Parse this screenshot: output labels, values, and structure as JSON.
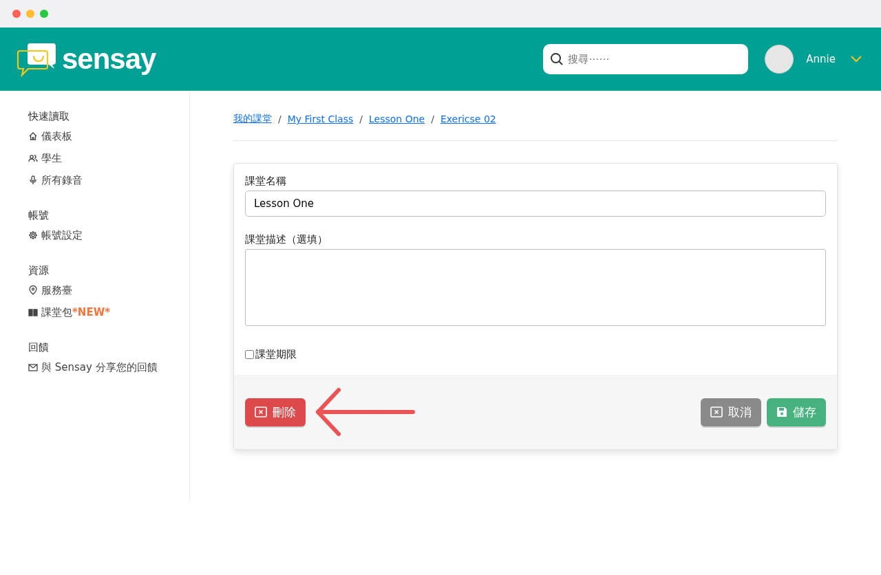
{
  "header": {
    "logo": "sensay",
    "search": {
      "placeholder": "搜尋⋯⋯"
    },
    "user": {
      "name": "Annie"
    }
  },
  "sidebar": {
    "sections": [
      {
        "title": "快速讀取",
        "items": [
          {
            "label": "儀表板"
          },
          {
            "label": "學生"
          },
          {
            "label": "所有錄音"
          }
        ]
      },
      {
        "title": "帳號",
        "items": [
          {
            "label": "帳號設定"
          }
        ]
      },
      {
        "title": "資源",
        "items": [
          {
            "label": "服務臺"
          },
          {
            "label": "課堂包",
            "badge": "*NEW*"
          }
        ]
      },
      {
        "title": "回饋",
        "items": [
          {
            "label": "與 Sensay 分享您的回饋"
          }
        ]
      }
    ]
  },
  "breadcrumb": {
    "separator": "/",
    "items": [
      "我的課堂",
      "My First Class",
      "Lesson One",
      "Exericse 02"
    ]
  },
  "form": {
    "name_label": "課堂名稱",
    "name_value": "Lesson One",
    "description_label": "課堂描述（選填）",
    "deadline": {
      "label": "課堂期限",
      "checked": false
    },
    "buttons": [
      {
        "label": "刪除",
        "kind": "danger"
      },
      {
        "label": "取消",
        "kind": "secondary"
      },
      {
        "label": "儲存",
        "kind": "primary"
      }
    ]
  }
}
